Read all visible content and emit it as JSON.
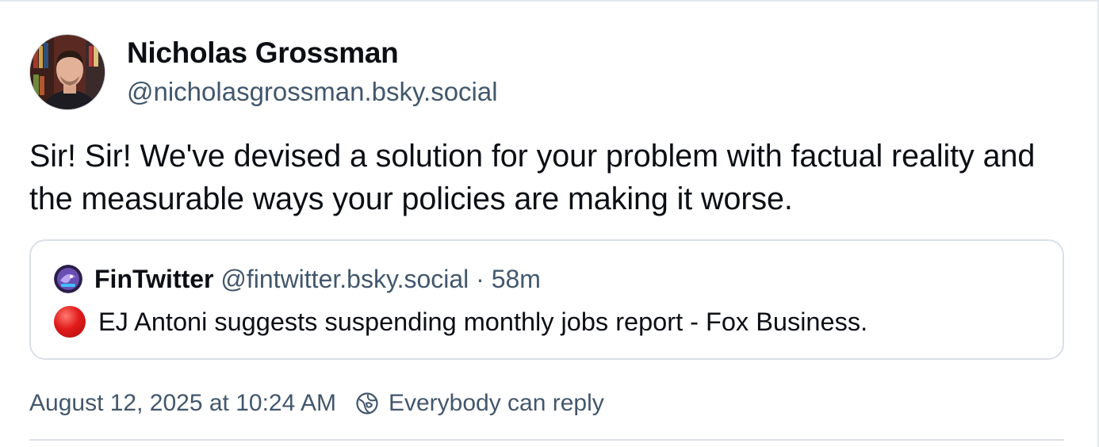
{
  "post": {
    "author": {
      "name": "Nicholas Grossman",
      "handle": "@nicholasgrossman.bsky.social"
    },
    "text": "Sir! Sir! We've devised a solution for your problem with factual reality and the measurable ways your policies are making it worse.",
    "quote": {
      "author_name": "FinTwitter",
      "handle_and_time": "@fintwitter.bsky.social · 58m",
      "text": "EJ Antoni suggests suspending monthly jobs report - Fox Business."
    },
    "timestamp": "August 12, 2025 at 10:24 AM",
    "reply_setting": "Everybody can reply"
  },
  "icons": {
    "reply_setting_icon": "globe-icon",
    "quote_bullet": "red-circle-emoji"
  },
  "colors": {
    "text": "#0b0f14",
    "secondary_text": "#42576c",
    "border": "#d9e0e7"
  }
}
